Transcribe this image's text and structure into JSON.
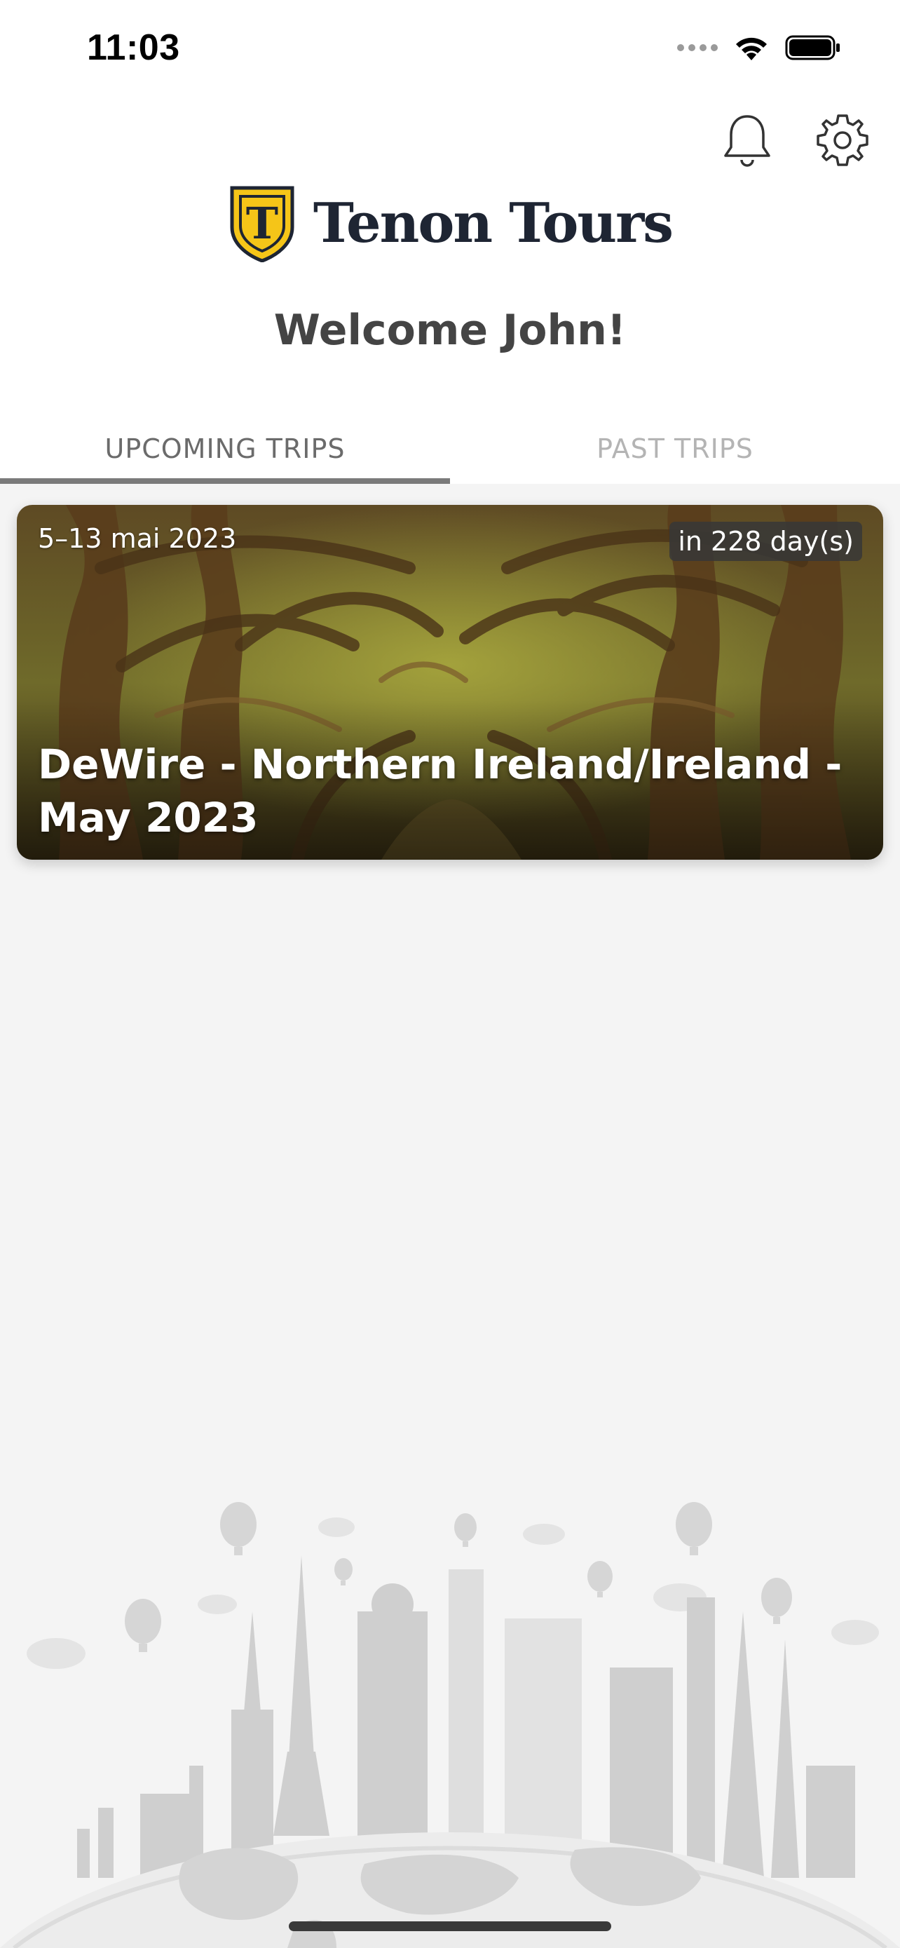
{
  "status_bar": {
    "time": "11:03",
    "icons": [
      "signal-icon",
      "wifi-icon",
      "battery-icon"
    ]
  },
  "header": {
    "icons": [
      "bell-icon",
      "gear-icon"
    ]
  },
  "brand": {
    "name": "Tenon Tours",
    "logo_letter": "T",
    "colors": {
      "shield": "#f5c518",
      "shield_outline": "#1e2533"
    }
  },
  "welcome": {
    "text": "Welcome John!"
  },
  "tabs": [
    {
      "label": "UPCOMING TRIPS",
      "active": true
    },
    {
      "label": "PAST TRIPS",
      "active": false
    }
  ],
  "trips": [
    {
      "date": "5–13 mai 2023",
      "countdown": "in 228 day(s)",
      "title": "DeWire - Northern Ireland/Ireland - May 2023"
    }
  ]
}
